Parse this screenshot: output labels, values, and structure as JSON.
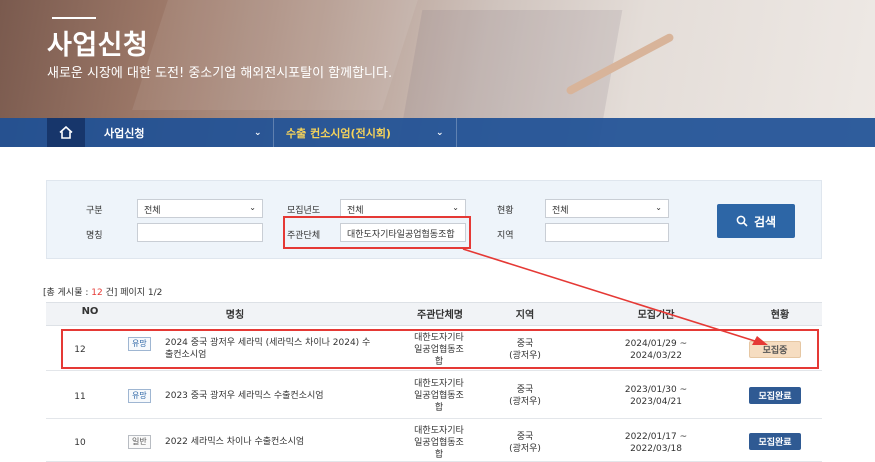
{
  "hero": {
    "title": "사업신청",
    "subtitle": "새로운 시장에 대한 도전! 중소기업 해외전시포탈이 함께합니다."
  },
  "nav": {
    "home_icon": "home-icon",
    "item1": "사업신청",
    "item2": "수출 컨소시엄(전시회)",
    "chevron": "⌄"
  },
  "search": {
    "category_label": "구분",
    "category_value": "전체",
    "year_label": "모집년도",
    "year_value": "전체",
    "status_label": "현황",
    "status_value": "전체",
    "name_label": "명칭",
    "name_value": "",
    "org_label": "주관단체",
    "org_value": "대한도자기타일공업협동조합",
    "region_label": "지역",
    "region_value": "",
    "button_label": "검색"
  },
  "count": {
    "prefix": "[총 게시물 : ",
    "total": "12",
    "suffix": " 건] 페이지 1/2"
  },
  "table": {
    "headers": [
      "NO",
      "명칭",
      "주관단체명",
      "지역",
      "모집기간",
      "현황"
    ],
    "rows": [
      {
        "no": "12",
        "tag": "유망",
        "name_line1": "2024 중국 광저우 세라믹 (세라믹스 차이나 2024) 수",
        "name_line2": "출컨소시엄",
        "org_line1": "대한도자기타",
        "org_line2": "일공업협동조",
        "org_line3": "합",
        "region_line1": "중국",
        "region_line2": "(광저우)",
        "period_line1": "2024/01/29 ~",
        "period_line2": "2024/03/22",
        "status": "모집중"
      },
      {
        "no": "11",
        "tag": "유망",
        "name_line1": "2023 중국 광저우 세라믹스 수출컨소시엄",
        "name_line2": "",
        "org_line1": "대한도자기타",
        "org_line2": "일공업협동조",
        "org_line3": "합",
        "region_line1": "중국",
        "region_line2": "(광저우)",
        "period_line1": "2023/01/30 ~",
        "period_line2": "2023/04/21",
        "status": "모집완료"
      },
      {
        "no": "10",
        "tag": "일반",
        "name_line1": "2022 세라믹스 차이나 수출컨소시엄",
        "name_line2": "",
        "org_line1": "대한도자기타",
        "org_line2": "일공업협동조",
        "org_line3": "합",
        "region_line1": "중국",
        "region_line2": "(광저우)",
        "period_line1": "2022/01/17 ~",
        "period_line2": "2022/03/18",
        "status": "모집완료"
      }
    ]
  },
  "colors": {
    "nav_blue": "#1e5096",
    "button_blue": "#2d66a6",
    "annotation_red": "#e53935",
    "status_open_bg": "#f6ddc1",
    "status_closed_bg": "#2f5a93"
  }
}
